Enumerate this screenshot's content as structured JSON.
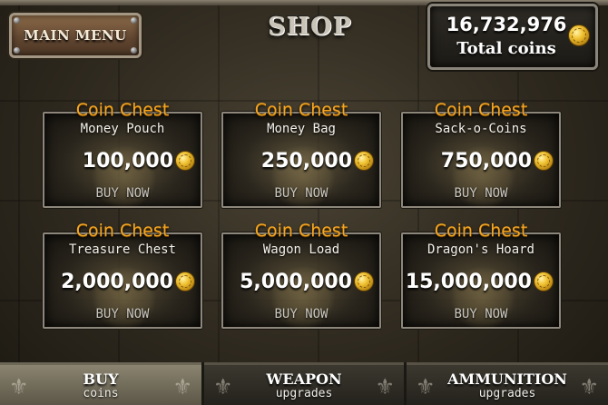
{
  "header": {
    "main_menu_label": "MAIN MENU",
    "title": "SHOP",
    "total_coins_value": "16,732,976",
    "total_coins_label": "Total coins"
  },
  "chests": [
    {
      "type": "Coin Chest",
      "name": "Money Pouch",
      "price": "100,000",
      "buy_label": "BUY NOW"
    },
    {
      "type": "Coin Chest",
      "name": "Money Bag",
      "price": "250,000",
      "buy_label": "BUY NOW"
    },
    {
      "type": "Coin Chest",
      "name": "Sack-o-Coins",
      "price": "750,000",
      "buy_label": "BUY NOW"
    },
    {
      "type": "Coin Chest",
      "name": "Treasure Chest",
      "price": "2,000,000",
      "buy_label": "BUY NOW"
    },
    {
      "type": "Coin Chest",
      "name": "Wagon Load",
      "price": "5,000,000",
      "buy_label": "BUY NOW"
    },
    {
      "type": "Coin Chest",
      "name": "Dragon's Hoard",
      "price": "15,000,000",
      "buy_label": "BUY NOW"
    }
  ],
  "tabs": [
    {
      "title": "BUY",
      "subtitle": "coins",
      "active": true
    },
    {
      "title": "WEAPON",
      "subtitle": "upgrades",
      "active": false
    },
    {
      "title": "AMMUNITION",
      "subtitle": "upgrades",
      "active": false
    }
  ],
  "icons": {
    "coin": "gold-coin-icon",
    "tab_decoration": "fleur-de-lis-icon"
  },
  "colors": {
    "chest_type": "#f5a623",
    "coin_gold": "#f1c232"
  }
}
